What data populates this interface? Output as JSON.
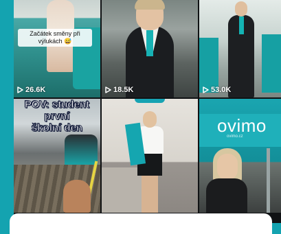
{
  "feed": {
    "tiles": [
      {
        "caption": [
          "Začátek směny při",
          "výlukách 😅"
        ],
        "views": "26.6K"
      },
      {
        "views": "18.5K"
      },
      {
        "views": "53.0K"
      },
      {
        "title": [
          "POV: student",
          "první",
          "školní den"
        ]
      },
      {},
      {
        "brand": "ovimo",
        "tagline": "ovimo.cz"
      }
    ]
  },
  "icons": {
    "views": "play-icon"
  },
  "colors": {
    "accent": "#14a3b0",
    "brand_teal": "#1fb0ba",
    "card": "#ffffff"
  }
}
